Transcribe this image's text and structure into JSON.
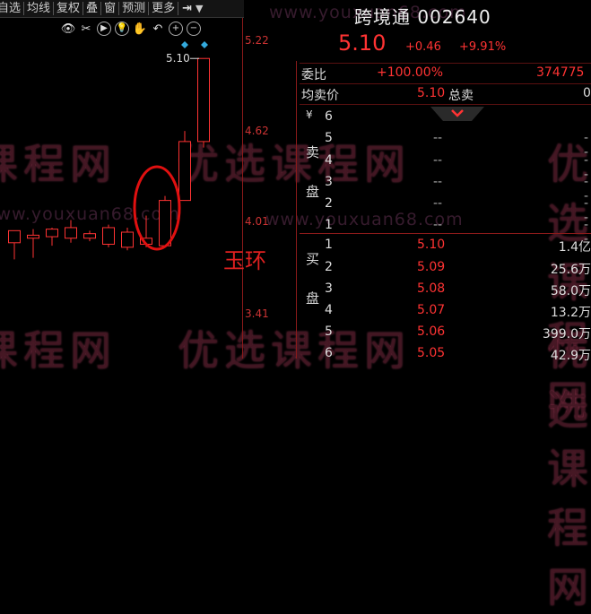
{
  "toolbar": {
    "items": [
      "自选",
      "均线",
      "复权",
      "叠",
      "窗",
      "预测",
      "更多"
    ],
    "pin_icon": "pin-icon",
    "dropdown_icon": "triangle-down-icon"
  },
  "chart_tools": [
    "eye-icon",
    "scissors-icon",
    "play-icon",
    "bulb-icon",
    "hand-icon",
    "undo-icon",
    "zoom-in-icon",
    "zoom-out-icon"
  ],
  "chart_data": {
    "type": "candlestick",
    "y_ticks": [
      "5.22",
      "4.62",
      "4.01",
      "3.41"
    ],
    "ylim": [
      3.41,
      5.22
    ],
    "latest_marker": "5.10",
    "candles": [
      {
        "o": 3.88,
        "h": 3.96,
        "l": 3.77,
        "c": 3.96
      },
      {
        "o": 3.91,
        "h": 3.97,
        "l": 3.78,
        "c": 3.93
      },
      {
        "o": 3.92,
        "h": 3.98,
        "l": 3.86,
        "c": 3.97
      },
      {
        "o": 3.91,
        "h": 4.03,
        "l": 3.88,
        "c": 3.98
      },
      {
        "o": 3.91,
        "h": 3.96,
        "l": 3.89,
        "c": 3.94
      },
      {
        "o": 3.87,
        "h": 4.0,
        "l": 3.85,
        "c": 3.98
      },
      {
        "o": 3.85,
        "h": 3.98,
        "l": 3.83,
        "c": 3.95
      },
      {
        "o": 3.87,
        "h": 4.06,
        "l": 3.85,
        "c": 3.91
      },
      {
        "o": 3.86,
        "h": 4.19,
        "l": 3.85,
        "c": 4.16
      },
      {
        "o": 4.16,
        "h": 4.62,
        "l": 4.16,
        "c": 4.55
      },
      {
        "o": 4.55,
        "h": 5.1,
        "l": 4.51,
        "c": 5.1
      }
    ],
    "colors": {
      "up": "#ff3333",
      "down": "#33dddd",
      "axis": "#c33"
    }
  },
  "annotation": "玉环",
  "quote": {
    "name": "跨境通",
    "code": "002640",
    "price": "5.10",
    "change": "+0.46",
    "pct": "+9.91%"
  },
  "weibi": {
    "label": "委比",
    "pct": "+100.00%",
    "value": "374775"
  },
  "avg": {
    "label": "均卖价",
    "value": "5.10",
    "total_label": "总卖",
    "total_value": "0"
  },
  "sell_side": {
    "chars": [
      "卖",
      "盘"
    ],
    "levels": [
      "6",
      "5",
      "4",
      "3",
      "2",
      "1"
    ],
    "dash": "--"
  },
  "buy_side": {
    "chars": [
      "买",
      "盘"
    ],
    "levels": [
      {
        "n": "1",
        "price": "5.10",
        "vol": "1.4亿"
      },
      {
        "n": "2",
        "price": "5.09",
        "vol": "25.6万"
      },
      {
        "n": "3",
        "price": "5.08",
        "vol": "58.0万"
      },
      {
        "n": "4",
        "price": "5.07",
        "vol": "13.2万"
      },
      {
        "n": "5",
        "price": "5.06",
        "vol": "399.0万"
      },
      {
        "n": "6",
        "price": "5.05",
        "vol": "42.9万"
      }
    ]
  },
  "yen_mark": "¥",
  "watermark": {
    "url": "www.youxuan68.com",
    "text": "优选课程网"
  }
}
